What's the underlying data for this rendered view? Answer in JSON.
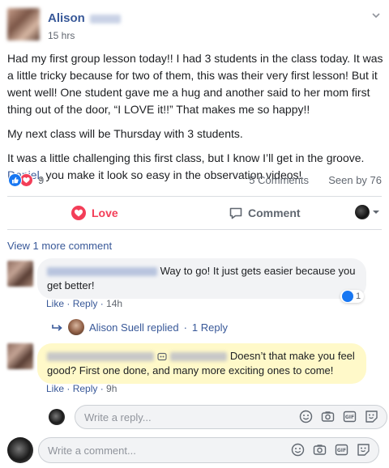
{
  "post": {
    "author_first": "Alison",
    "time": "15 hrs",
    "paragraphs": {
      "p1": "Had my first group lesson today!! I had 3 students in the class today. It was a little tricky because for two of them, this was their very first lesson! But it went well! One student gave me a hug and another said to her mom first thing out of the door, “I LOVE it!!” That makes me so happy!!",
      "p2": "My next class will be Thursday with 3 students.",
      "p3_before": "It was a little challenging this first class, but I know I’ll get in the groove. ",
      "p3_mention": "Daniel",
      "p3_after": ", you make it look so easy in the observation videos!"
    },
    "reaction_count": "9",
    "comments_count": "5 Comments",
    "seen_by": "Seen by 76"
  },
  "actions": {
    "love_label": "Love",
    "comment_label": "Comment"
  },
  "comments": {
    "view_more": "View 1 more comment",
    "c1": {
      "text": "Way to go! It just gets easier because you get better!",
      "like": "Like",
      "reply": "Reply",
      "time": "14h",
      "like_count": "1"
    },
    "replied": {
      "text": "Alison Suell replied",
      "separator": "·",
      "replies": "1 Reply"
    },
    "c2": {
      "text": "Doesn’t that make you feel good? First one done, and many more exciting ones to come!",
      "like": "Like",
      "reply": "Reply",
      "time": "9h"
    },
    "reply_placeholder": "Write a reply...",
    "comment_placeholder": "Write a comment..."
  },
  "colors": {
    "link": "#385898",
    "love": "#f33e58",
    "like": "#1877f2",
    "highlight": "#fff9c9"
  },
  "icons": [
    "chevron-down-icon",
    "like-reaction-icon",
    "love-reaction-icon",
    "heart-icon",
    "comment-icon",
    "audience-dropdown-icon",
    "reply-arrow-icon",
    "smiley-icon",
    "camera-icon",
    "gif-icon",
    "sticker-icon",
    "sticker-badge-icon"
  ]
}
